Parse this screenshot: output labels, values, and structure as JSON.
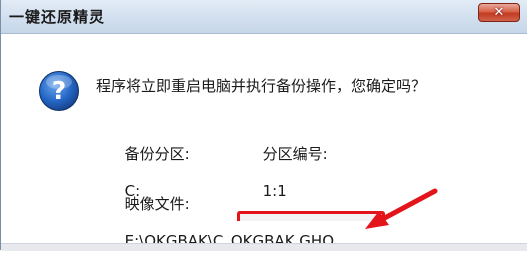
{
  "window": {
    "title": "一键还原精灵"
  },
  "message": {
    "question": "程序将立即重启电脑并执行备份操作，您确定吗？",
    "partition_label": "备份分区:",
    "partition_value": "C:",
    "number_label": "分区编号:",
    "number_value": "1:1",
    "image_label": "映像文件:",
    "image_value": "E:\\OKGBAK\\C_OKGBAK.GHO"
  },
  "colors": {
    "highlight": "#e4141b",
    "icon_blue": "#1f5fb8"
  },
  "icons": {
    "question": "question-icon",
    "close": "close-icon",
    "arrow": "arrow-icon"
  }
}
